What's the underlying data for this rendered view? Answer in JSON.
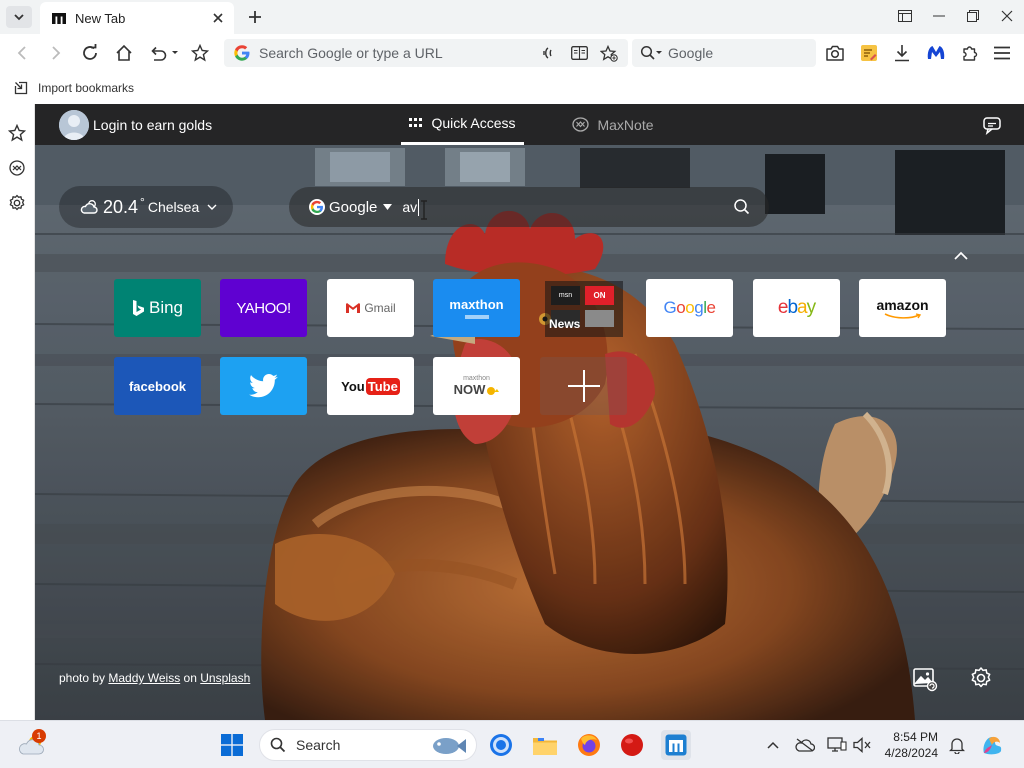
{
  "browser": {
    "tab": {
      "title": "New Tab"
    },
    "address_bar": {
      "placeholder": "Search Google or type a URL"
    },
    "search_box": {
      "placeholder": "Google"
    },
    "bookmarks_bar": {
      "import_label": "Import bookmarks"
    }
  },
  "page": {
    "topbar": {
      "login_label": "Login to earn golds",
      "tabs": [
        {
          "label": "Quick Access",
          "active": true
        },
        {
          "label": "MaxNote",
          "active": false
        }
      ]
    },
    "weather": {
      "temperature": "20.4",
      "unit": "°",
      "city": "Chelsea",
      "icon": "partly-cloudy-icon"
    },
    "search": {
      "engine": "Google",
      "query": "av"
    },
    "quick_access_tiles": [
      {
        "name": "bing",
        "label": "Bing",
        "bg": "#008373"
      },
      {
        "name": "yahoo",
        "label": "YAHOO!",
        "bg": "#5f01d1"
      },
      {
        "name": "gmail",
        "label": "Gmail",
        "bg": "#ffffff"
      },
      {
        "name": "maxthon",
        "label": "maxthon",
        "bg": "#1a8cf0"
      },
      {
        "name": "news",
        "label": "News",
        "bg": "#1b1b1b"
      },
      {
        "name": "google",
        "label": "Google",
        "bg": "#ffffff"
      },
      {
        "name": "ebay",
        "label": "ebay",
        "bg": "#ffffff"
      },
      {
        "name": "amazon",
        "label": "amazon",
        "bg": "#ffffff"
      },
      {
        "name": "facebook",
        "label": "facebook",
        "bg": "#1c57b8"
      },
      {
        "name": "twitter",
        "label": "",
        "bg": "#1da1f2"
      },
      {
        "name": "youtube",
        "label": "YouTube",
        "bg": "#ffffff"
      },
      {
        "name": "maxthon-now",
        "label": "NOW",
        "bg": "#ffffff"
      },
      {
        "name": "add",
        "label": "",
        "bg": "rgba(120,90,80,0.35)"
      }
    ],
    "news_tile_badges": {
      "left": "msn",
      "right": "ON"
    },
    "maxthon_now_small": "maxthon",
    "photo_credit": {
      "prefix": "photo by",
      "author": "Maddy Weiss",
      "mid": "on",
      "source": "Unsplash"
    }
  },
  "taskbar": {
    "weather_badge": "1",
    "search_label": "Search",
    "time": "8:54 PM",
    "date": "4/28/2024"
  }
}
